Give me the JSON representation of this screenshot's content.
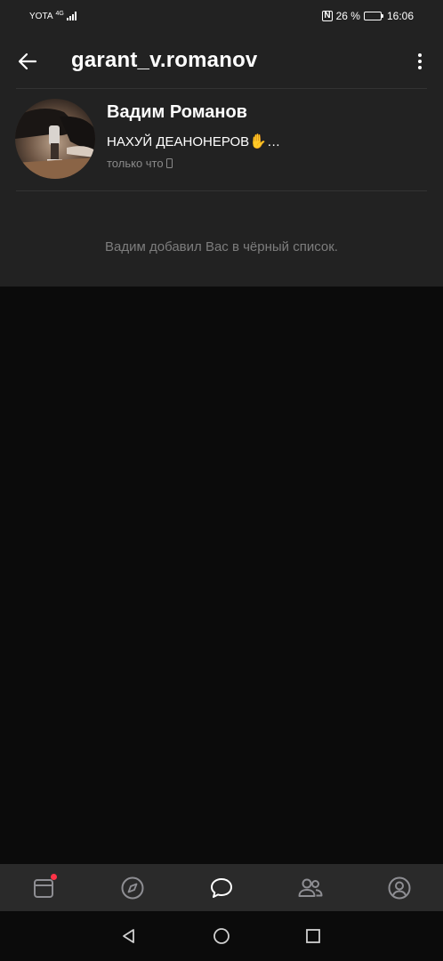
{
  "status_bar": {
    "carrier": "YOTA",
    "network_type": "4G",
    "battery_percent": "26 %",
    "battery_level": 0.26,
    "time": "16:06"
  },
  "header": {
    "title": "garant_v.romanov"
  },
  "profile": {
    "name": "Вадим Романов",
    "status_text": "НАХУЙ ДЕАНОНЕРОВ",
    "status_emoji": "✋",
    "status_ellipsis": "…",
    "last_seen": "только что"
  },
  "blacklist_message": "Вадим добавил Вас в чёрный список.",
  "tab_bar": {
    "tabs": [
      "news-icon",
      "explore-icon",
      "messages-icon",
      "friends-icon",
      "profile-icon"
    ],
    "active": "messages-icon"
  },
  "android_nav": [
    "back",
    "home",
    "recents"
  ],
  "colors": {
    "surface": "#222222",
    "background": "#0b0b0b",
    "tab_bar": "#2a2a2a",
    "muted_text": "#7d7d7d",
    "badge": "#ff3347"
  }
}
